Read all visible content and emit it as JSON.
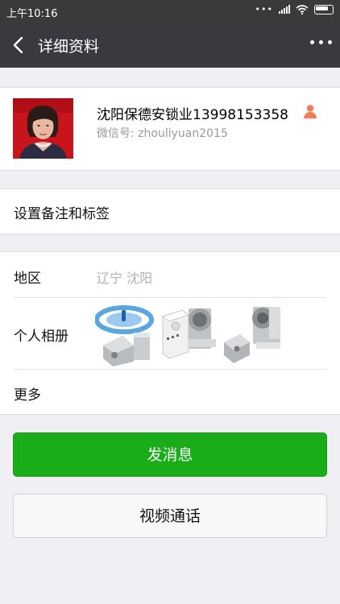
{
  "status_bar": {
    "time": "上午10:16",
    "dots": "•••"
  },
  "nav": {
    "title": "详细资料",
    "back_icon": "chevron-left-icon",
    "more_icon": "more-dots-icon"
  },
  "profile": {
    "name": "沈阳保德安锁业13998153358",
    "wechat_id": "微信号: zhouliyuan2015",
    "gender_icon": "person-icon",
    "gender_icon_color": "#f37b57"
  },
  "remark": {
    "label": "设置备注和标签"
  },
  "info": {
    "region_label": "地区",
    "region_value": "辽宁  沈阳",
    "album_label": "个人相册",
    "more_label": "更多"
  },
  "actions": {
    "send_message": "发消息",
    "video_call": "视频通话"
  },
  "colors": {
    "nav_bg": "#393a3f",
    "primary_green": "#1aad19",
    "page_bg": "#efeff4"
  }
}
